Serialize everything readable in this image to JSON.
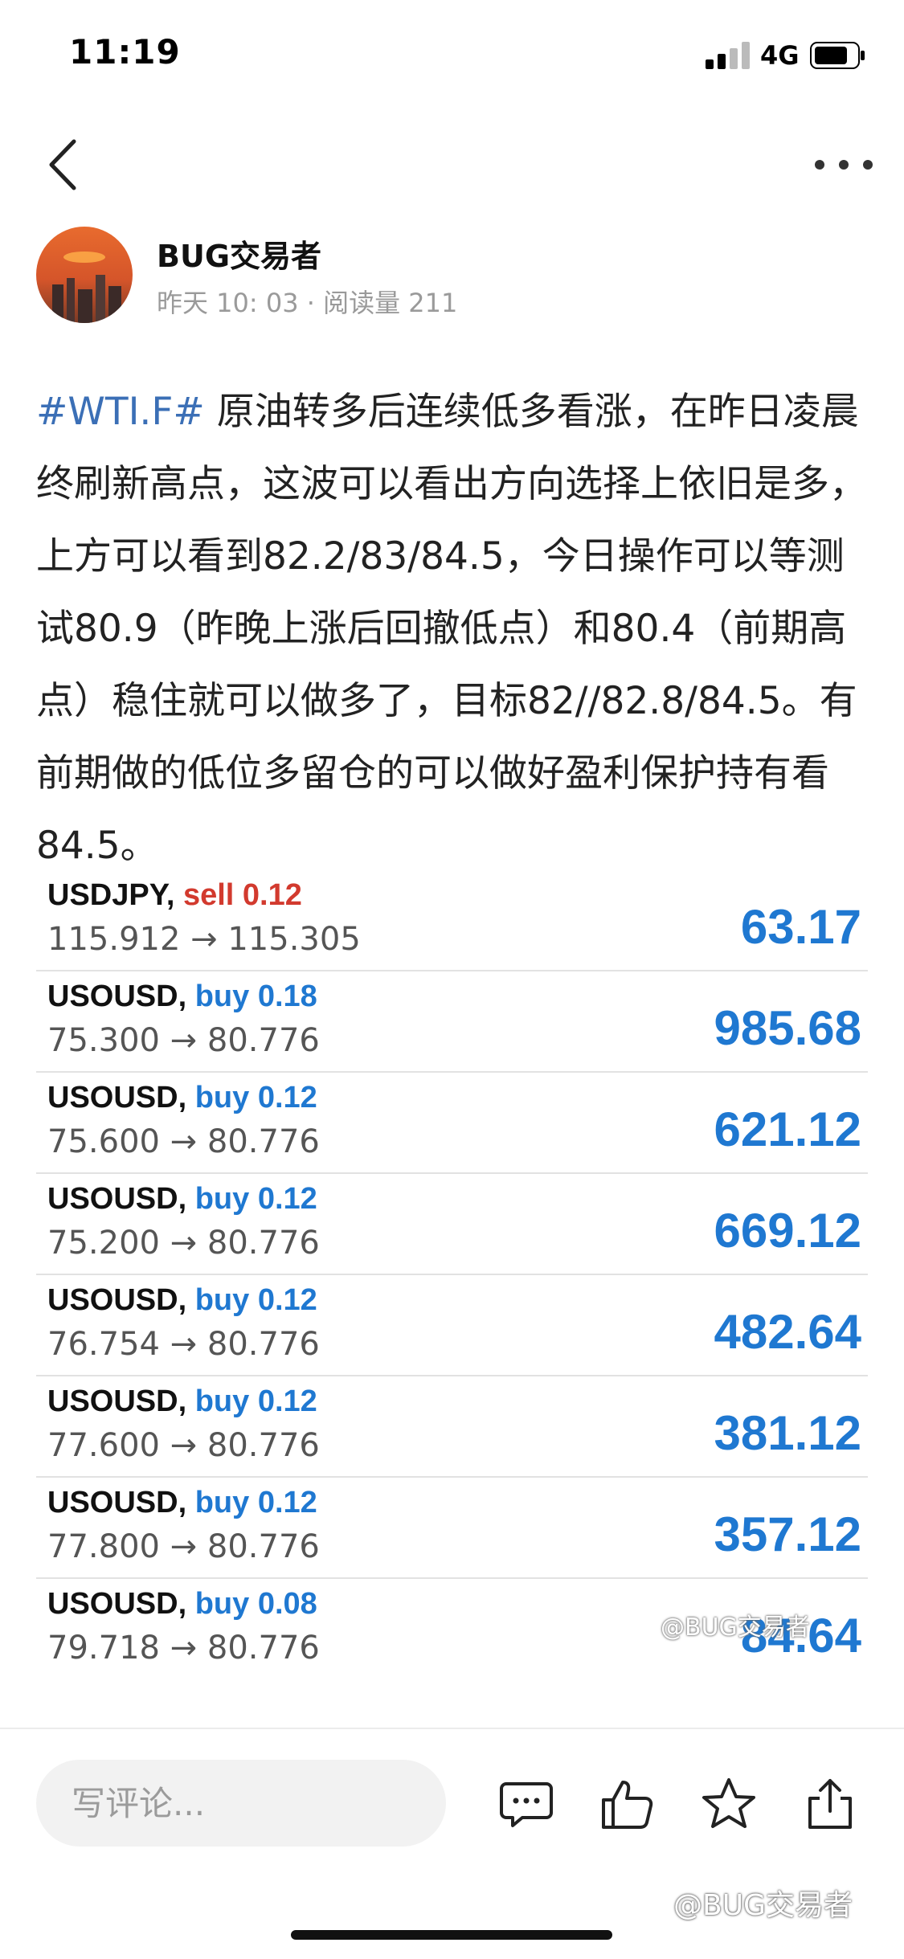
{
  "status": {
    "time": "11:19",
    "network": "4G"
  },
  "author": {
    "name": "BUG交易者",
    "meta": "昨天 10: 03 · 阅读量 211"
  },
  "post": {
    "hashtag": "#WTI.F#",
    "text": " 原油转多后连续低多看涨，在昨日凌晨终刷新高点，这波可以看出方向选择上依旧是多，上方可以看到82.2/83/84.5，今日操作可以等测试80.9（昨晚上涨后回撤低点）和80.4（前期高点）稳住就可以做多了，目标82//82.8/84.5。有前期做的低位多留仓的可以做好盈利保护持有看84.5。"
  },
  "trades": [
    {
      "symbol": "USDJPY,",
      "side": "sell",
      "lots": "0.12",
      "prices": "115.912 → 115.305",
      "profit": "63.17"
    },
    {
      "symbol": "USOUSD,",
      "side": "buy",
      "lots": "0.18",
      "prices": "75.300 → 80.776",
      "profit": "985.68"
    },
    {
      "symbol": "USOUSD,",
      "side": "buy",
      "lots": "0.12",
      "prices": "75.600 → 80.776",
      "profit": "621.12"
    },
    {
      "symbol": "USOUSD,",
      "side": "buy",
      "lots": "0.12",
      "prices": "75.200 → 80.776",
      "profit": "669.12"
    },
    {
      "symbol": "USOUSD,",
      "side": "buy",
      "lots": "0.12",
      "prices": "76.754 → 80.776",
      "profit": "482.64"
    },
    {
      "symbol": "USOUSD,",
      "side": "buy",
      "lots": "0.12",
      "prices": "77.600 → 80.776",
      "profit": "381.12"
    },
    {
      "symbol": "USOUSD,",
      "side": "buy",
      "lots": "0.12",
      "prices": "77.800 → 80.776",
      "profit": "357.12"
    },
    {
      "symbol": "USOUSD,",
      "side": "buy",
      "lots": "0.08",
      "prices": "79.718 → 80.776",
      "profit": "84.64"
    }
  ],
  "watermark": "@BUG交易者",
  "bottom_bar": {
    "comment_placeholder": "写评论...",
    "icons": [
      "comment-icon",
      "like-icon",
      "star-icon",
      "share-icon"
    ]
  },
  "colors": {
    "buy": "#1f78d1",
    "sell": "#d23a2e",
    "hashtag": "#3b6fb6"
  }
}
